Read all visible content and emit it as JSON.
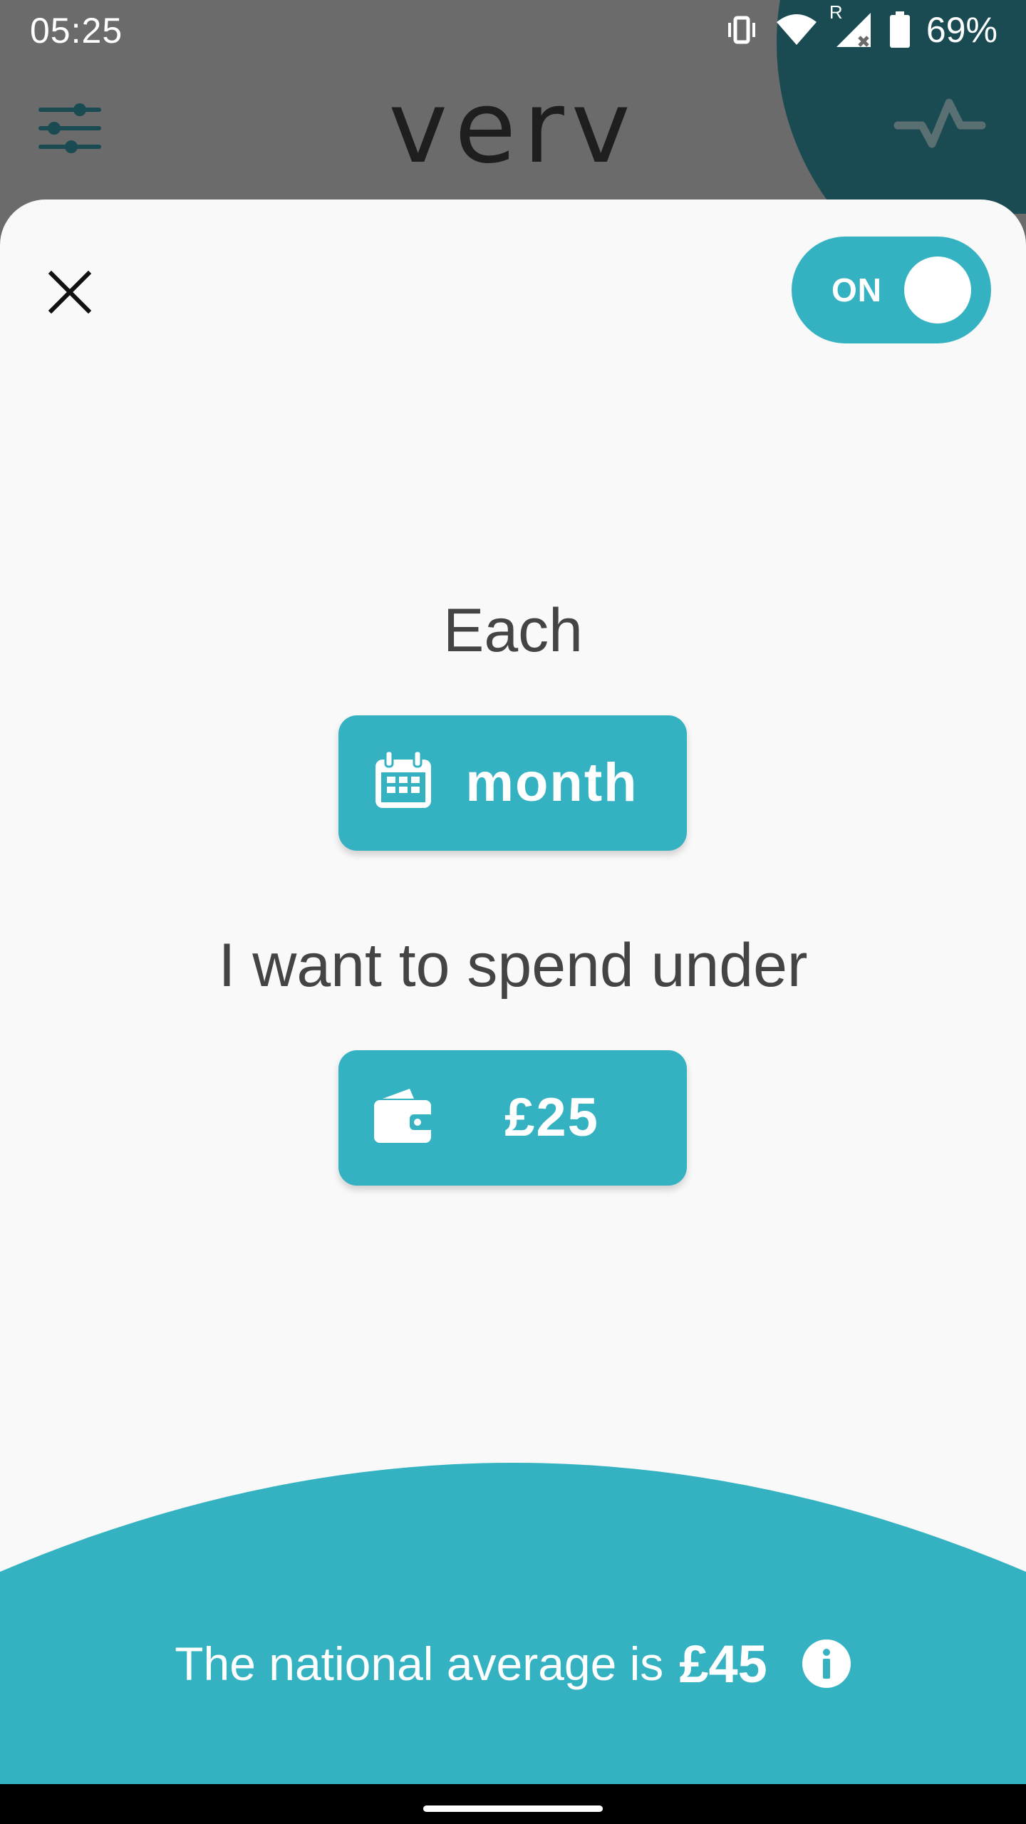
{
  "status_bar": {
    "time": "05:25",
    "battery_percent": "69%",
    "roaming_label": "R",
    "icons": [
      "vibrate-icon",
      "wifi-icon",
      "signal-icon",
      "battery-icon"
    ]
  },
  "app_bar": {
    "logo": "verv",
    "left_icon": "filter-sliders-icon",
    "right_icon": "pulse-icon"
  },
  "sheet": {
    "close_icon": "close-icon",
    "toggle": {
      "label": "ON",
      "state": "on"
    },
    "period_heading": "Each",
    "period_value": "month",
    "period_icon": "calendar-icon",
    "spend_heading": "I want to spend under",
    "spend_value": "£25",
    "spend_icon": "wallet-icon"
  },
  "footer": {
    "average_text": "The national average is",
    "average_value": "£45",
    "info_icon": "info-icon"
  },
  "colors": {
    "accent": "#34b2c1",
    "dark_teal": "#1a4a52",
    "scrim": "#6b6b6b",
    "sheet_background": "#f9f9f9",
    "heading_text": "#444444"
  }
}
